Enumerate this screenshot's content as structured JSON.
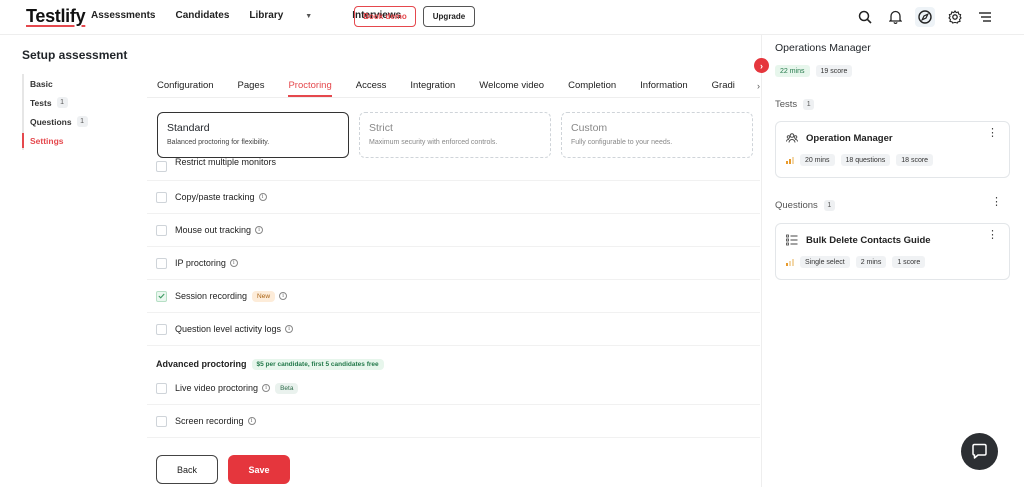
{
  "brand": {
    "logo": "Testlify",
    "accent": "#e5484d"
  },
  "nav": {
    "items": [
      "Assessments",
      "Candidates",
      "Library",
      "Interviews"
    ],
    "book_demo": "Book demo",
    "upgrade": "Upgrade"
  },
  "top_icons": [
    "search-icon",
    "bell-icon",
    "compass-icon",
    "gear-icon",
    "menu-icon"
  ],
  "page": {
    "title": "Setup assessment"
  },
  "steps": [
    {
      "label": "Basic",
      "count": ""
    },
    {
      "label": "Tests",
      "count": "1"
    },
    {
      "label": "Questions",
      "count": "1"
    },
    {
      "label": "Settings",
      "count": ""
    }
  ],
  "tabs": [
    "Configuration",
    "Pages",
    "Proctoring",
    "Access",
    "Integration",
    "Welcome video",
    "Completion",
    "Information",
    "Gradi"
  ],
  "active_tab": "Proctoring",
  "modes": [
    {
      "title": "Standard",
      "desc": "Balanced proctoring for flexibility."
    },
    {
      "title": "Strict",
      "desc": "Maximum security with enforced controls."
    },
    {
      "title": "Custom",
      "desc": "Fully configurable to your needs."
    }
  ],
  "options": {
    "restrict_monitors": "Restrict multiple monitors",
    "copy_paste": "Copy/paste tracking",
    "mouse_out": "Mouse out tracking",
    "ip": "IP proctoring",
    "session": "Session recording",
    "session_badge": "New",
    "question_logs": "Question level activity logs"
  },
  "advanced": {
    "title": "Advanced proctoring",
    "price": "$5 per candidate, first 5 candidates free",
    "live_video": "Live video proctoring",
    "live_badge": "Beta",
    "screen": "Screen recording"
  },
  "actions": {
    "back": "Back",
    "save": "Save"
  },
  "panel": {
    "title": "Operations Manager",
    "duration": "22 mins",
    "score": "19 score",
    "tests_label": "Tests",
    "tests_count": "1",
    "test": {
      "name": "Operation Manager",
      "mins": "20 mins",
      "questions": "18 questions",
      "score": "18 score"
    },
    "questions_label": "Questions",
    "questions_count": "1",
    "question": {
      "name": "Bulk Delete Contacts Guide",
      "type": "Single select",
      "mins": "2 mins",
      "score": "1 score"
    }
  }
}
